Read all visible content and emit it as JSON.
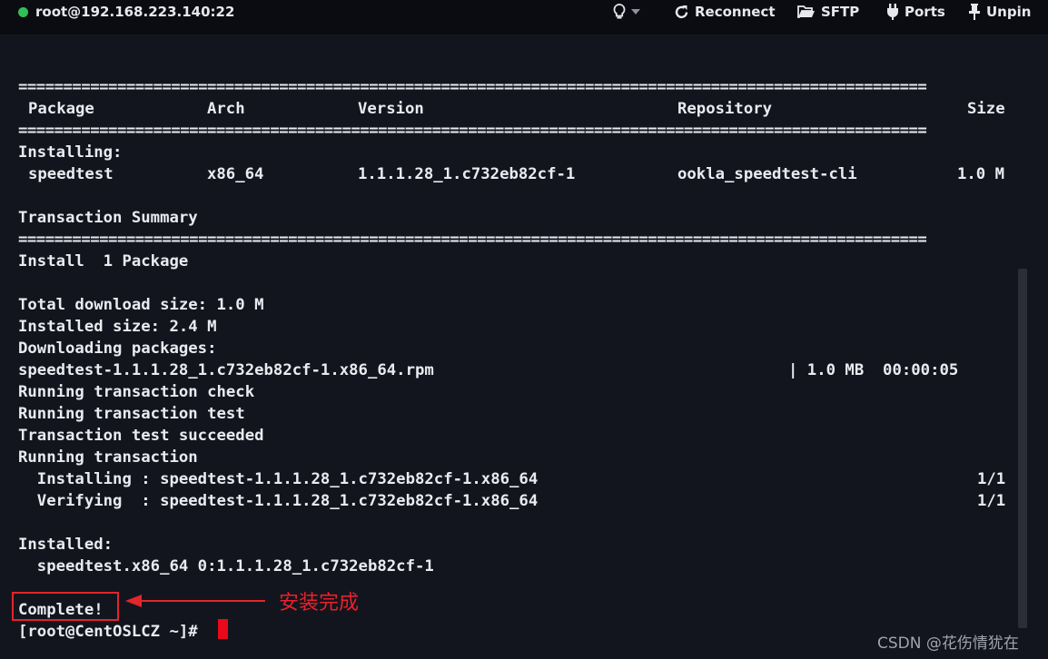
{
  "topbar": {
    "connection": "root@192.168.223.140:22",
    "reconnect": "Reconnect",
    "sftp": "SFTP",
    "ports": "Ports",
    "unpin": "Unpin"
  },
  "terminal": {
    "rule": "=====================================================================================================",
    "header": {
      "package": "Package",
      "arch": "Arch",
      "version": "Version",
      "repository": "Repository",
      "size": "Size"
    },
    "installing_label": "Installing:",
    "pkg_row": {
      "package": "speedtest",
      "arch": "x86_64",
      "version": "1.1.1.28_1.c732eb82cf-1",
      "repository": "ookla_speedtest-cli",
      "size": "1.0 M"
    },
    "transaction_summary": "Transaction Summary",
    "install_count": "Install  1 Package",
    "total_download": "Total download size: 1.0 M",
    "installed_size": "Installed size: 2.4 M",
    "downloading": "Downloading packages:",
    "rpm_file": "speedtest-1.1.1.28_1.c732eb82cf-1.x86_64.rpm",
    "rpm_stats": "| 1.0 MB  00:00:05",
    "check": "Running transaction check",
    "test": "Running transaction test",
    "test_ok": "Transaction test succeeded",
    "running": "Running transaction",
    "installing_step": "  Installing : speedtest-1.1.1.28_1.c732eb82cf-1.x86_64",
    "installing_prog": "1/1",
    "verifying_step": "  Verifying  : speedtest-1.1.1.28_1.c732eb82cf-1.x86_64",
    "verifying_prog": "1/1",
    "installed_label": "Installed:",
    "installed_pkg": "  speedtest.x86_64 0:1.1.1.28_1.c732eb82cf-1",
    "complete": "Complete!",
    "prompt": "[root@CentOSLCZ ~]#"
  },
  "annotation": {
    "text": "安装完成",
    "color": "#e8212a"
  },
  "watermark": "CSDN @花伤情犹在",
  "colors": {
    "background": "#13151e",
    "topbar": "#0b0c11",
    "status_dot": "#2fbf5b",
    "cursor": "#e8091b"
  }
}
